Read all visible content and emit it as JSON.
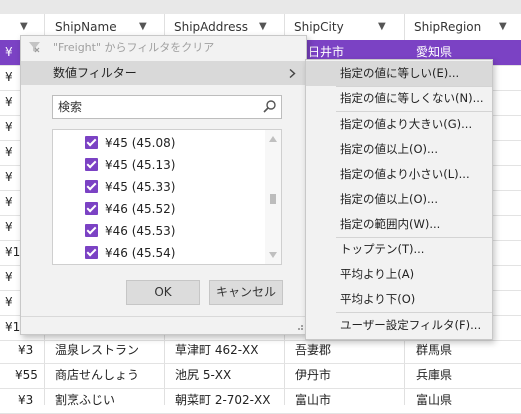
{
  "header": {
    "columns": [
      "ShipName",
      "ShipAddress",
      "ShipCity",
      "ShipRegion"
    ],
    "filter_glyph": "▼"
  },
  "rows_partial_freight": [
    "¥",
    "¥",
    "¥",
    "¥",
    "¥",
    "¥",
    "¥",
    "¥1",
    "¥",
    "¥",
    "¥1"
  ],
  "selected_row": {
    "freight": "¥",
    "city": "日井市",
    "region": "愛知県"
  },
  "rows": [
    {
      "freight": "¥3",
      "name": "温泉レストラン",
      "address": "草津町 462-XX",
      "city": "吾妻郡",
      "region": "群馬県"
    },
    {
      "freight": "¥55",
      "name": "商店せんしょう",
      "address": "池尻 5-XX",
      "city": "伊丹市",
      "region": "兵庫県"
    },
    {
      "freight": "¥3",
      "name": "割烹ふじい",
      "address": "朝菜町 2-702-XX",
      "city": "富山市",
      "region": "富山県"
    }
  ],
  "filter_popup": {
    "clear_filter_label": "\"Freight\" からフィルタをクリア",
    "number_filter_label": "数値フィルター",
    "search_placeholder": "検索",
    "values": [
      "¥45 (45.08)",
      "¥45 (45.13)",
      "¥45 (45.33)",
      "¥46 (45.52)",
      "¥46 (45.53)",
      "¥46 (45.54)"
    ],
    "ok_label": "OK",
    "cancel_label": "キャンセル"
  },
  "submenu": {
    "items": [
      "指定の値に等しい(E)...",
      "指定の値に等しくない(N)...",
      "指定の値より大きい(G)...",
      "指定の値以上(O)...",
      "指定の値より小さい(L)...",
      "指定の値以上(O)...",
      "指定の範囲内(W)...",
      "トップテン(T)...",
      "平均より上(A)",
      "平均より下(O)",
      "ユーザー設定フィルタ(F)..."
    ]
  },
  "colors": {
    "accent": "#7b42c4",
    "selected_row_bg": "#7b42c4",
    "menu_highlight": "#d9d9d9"
  }
}
